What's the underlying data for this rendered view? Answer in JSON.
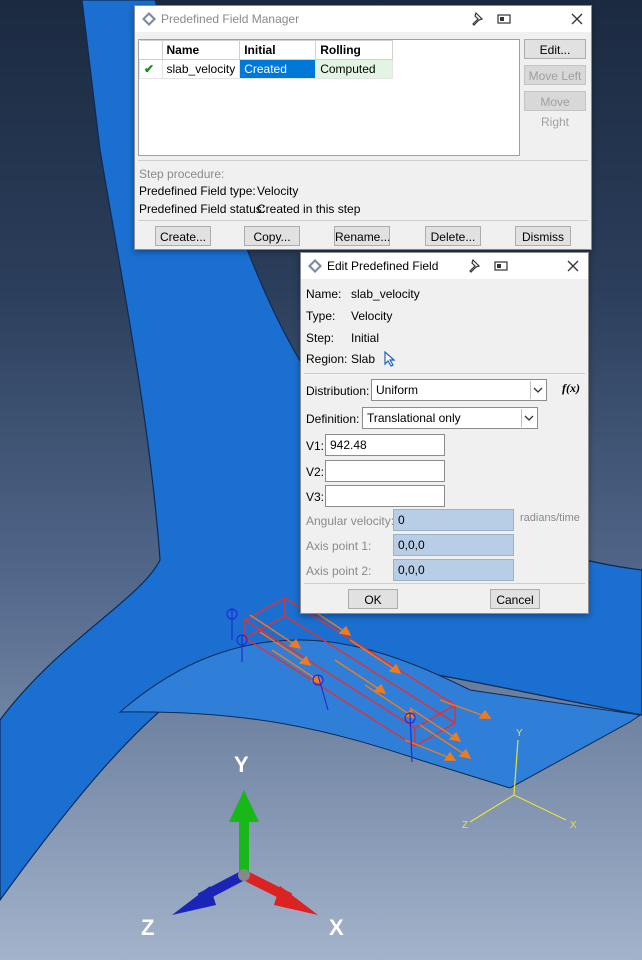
{
  "manager": {
    "title": "Predefined Field Manager",
    "columns": [
      "Name",
      "Initial",
      "Rolling"
    ],
    "rows": [
      {
        "check": "✔",
        "name": "slab_velocity",
        "initial": "Created",
        "rolling": "Computed"
      }
    ],
    "buttons": {
      "edit": "Edit...",
      "move_left": "Move Left",
      "move_right": "Move Right"
    },
    "step_procedure_label": "Step procedure:",
    "field_type_label": "Predefined Field type:",
    "field_type_value": "Velocity",
    "field_status_label": "Predefined Field status:",
    "field_status_value": "Created in this step",
    "bottom_buttons": {
      "create": "Create...",
      "copy": "Copy...",
      "rename": "Rename...",
      "delete": "Delete...",
      "dismiss": "Dismiss"
    }
  },
  "editor": {
    "title": "Edit Predefined Field",
    "name_label": "Name:",
    "name_value": "slab_velocity",
    "type_label": "Type:",
    "type_value": "Velocity",
    "step_label": "Step:",
    "step_value": "Initial",
    "region_label": "Region:",
    "region_value": "Slab",
    "distribution_label": "Distribution:",
    "distribution_value": "Uniform",
    "fx_label": "f(x)",
    "definition_label": "Definition:",
    "definition_value": "Translational only",
    "v1_label": "V1:",
    "v1_value": "942.48",
    "v2_label": "V2:",
    "v2_value": "",
    "v3_label": "V3:",
    "v3_value": "",
    "angular_label": "Angular velocity:",
    "angular_value": "0",
    "angular_unit": "radians/time",
    "axis1_label": "Axis point 1:",
    "axis1_value": "0,0,0",
    "axis2_label": "Axis point 2:",
    "axis2_value": "0,0,0",
    "ok": "OK",
    "cancel": "Cancel"
  },
  "triad": {
    "y": "Y",
    "z": "Z",
    "x": "X"
  },
  "small_triad": {
    "y": "Y",
    "z": "Z",
    "x": "X"
  },
  "colors": {
    "selection": "#0078d7",
    "rolling_bg": "#e2f5e2",
    "model": "#1a6fd0",
    "boundary_arrow": "#f07a1e",
    "box": "#e53030"
  }
}
